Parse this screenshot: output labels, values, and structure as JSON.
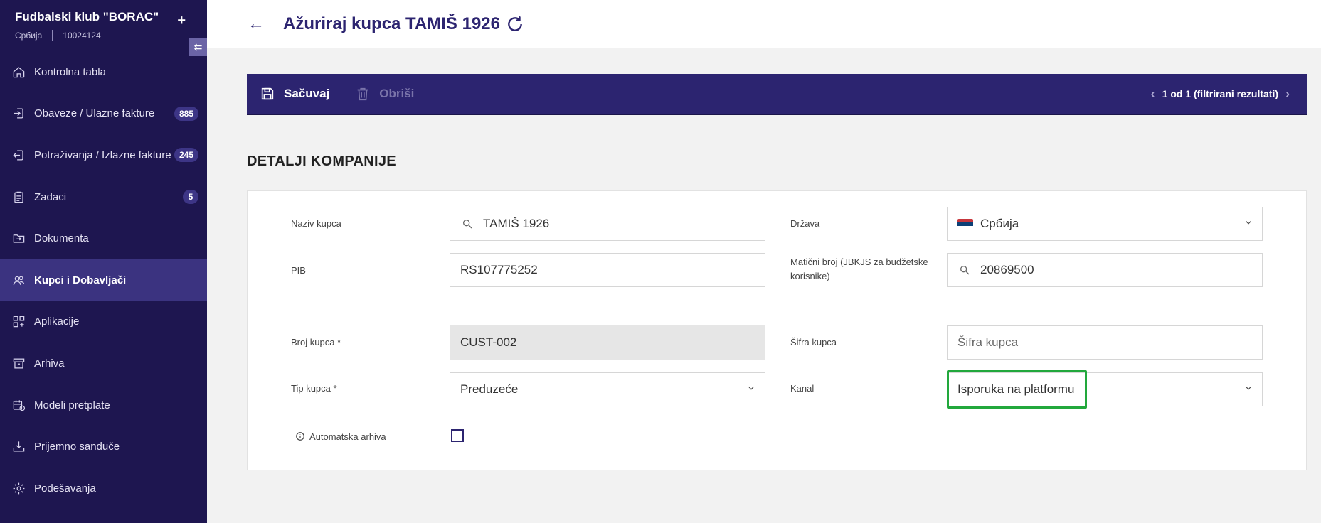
{
  "sidebar": {
    "org_name": "Fudbalski klub \"BORAC\"",
    "org_country": "Србија",
    "org_id": "10024124",
    "add_label": "+",
    "collapse_label": "⇇",
    "items": [
      {
        "label": "Kontrolna tabla",
        "icon": "home-icon",
        "badge": ""
      },
      {
        "label": "Obaveze / Ulazne fakture",
        "icon": "login-icon",
        "badge": "885"
      },
      {
        "label": "Potraživanja / Izlazne fakture",
        "icon": "logout-icon",
        "badge": "245"
      },
      {
        "label": "Zadaci",
        "icon": "clipboard-icon",
        "badge": "5"
      },
      {
        "label": "Dokumenta",
        "icon": "folder-sync-icon",
        "badge": ""
      },
      {
        "label": "Kupci i Dobavljači",
        "icon": "users-icon",
        "badge": ""
      },
      {
        "label": "Aplikacije",
        "icon": "apps-icon",
        "badge": ""
      },
      {
        "label": "Arhiva",
        "icon": "archive-icon",
        "badge": ""
      },
      {
        "label": "Modeli pretplate",
        "icon": "calendar-sync-icon",
        "badge": ""
      },
      {
        "label": "Prijemno sanduče",
        "icon": "inbox-download-icon",
        "badge": ""
      },
      {
        "label": "Podešavanja",
        "icon": "gear-icon",
        "badge": ""
      }
    ],
    "active_index": 5
  },
  "header": {
    "title": "Ažuriraj kupca TAMIŠ 1926",
    "back_icon": "arrow-left-icon",
    "title_icon": "refresh-icon"
  },
  "toolbar": {
    "save_label": "Sačuvaj",
    "delete_label": "Obriši",
    "pager_text": "1 od 1 (filtrirani rezultati)"
  },
  "section": {
    "title": "DETALJI KOMPANIJE"
  },
  "form": {
    "naziv_label": "Naziv kupca",
    "naziv_value": "TAMIŠ 1926",
    "drzava_label": "Država",
    "drzava_value": "Србија",
    "pib_label": "PIB",
    "pib_value": "RS107775252",
    "maticni_label": "Matični broj (JBKJS za budžetske korisnike)",
    "maticni_value": "20869500",
    "broj_label": "Broj kupca *",
    "broj_value": "CUST-002",
    "sifra_label": "Šifra kupca",
    "sifra_placeholder": "Šifra kupca",
    "tip_label": "Tip kupca *",
    "tip_value": "Preduzeće",
    "kanal_label": "Kanal",
    "kanal_value": "Isporuka na platformu",
    "arhiva_label": "Automatska arhiva",
    "arhiva_checked": false,
    "highlight_color": "#22a83c"
  },
  "colors": {
    "sidebar_bg": "#1e1650",
    "accent": "#2c2470",
    "active_item": "#3b3380"
  }
}
